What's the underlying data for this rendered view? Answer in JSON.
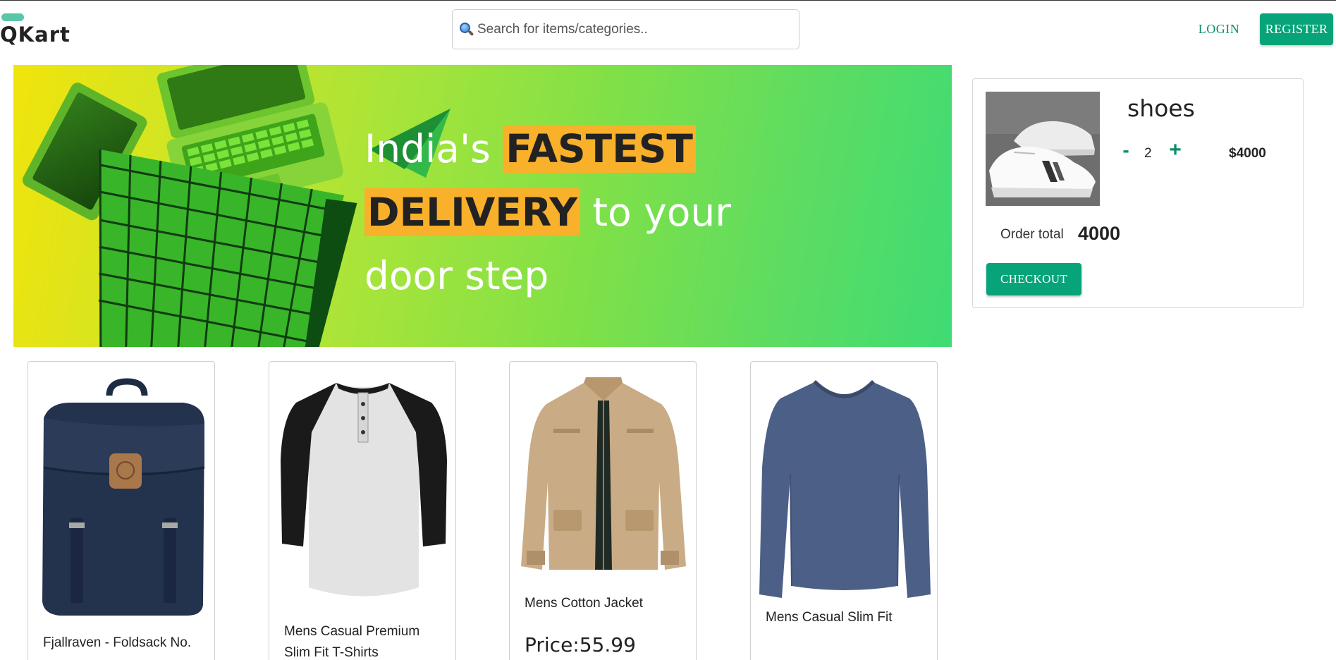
{
  "header": {
    "logo": "QKart",
    "search_placeholder": "Search for items/categories..",
    "login_label": "LOGIN",
    "register_label": "REGISTER"
  },
  "banner": {
    "line1_prefix": "India's ",
    "line1_highlight": "FASTEST",
    "line2_highlight": "DELIVERY",
    "line2_suffix": " to your",
    "line3": "door step"
  },
  "cart": {
    "item_name": "shoes",
    "quantity": "2",
    "minus_label": "-",
    "plus_label": "+",
    "item_price": "$4000",
    "order_total_label": "Order total",
    "order_total_value": "4000",
    "checkout_label": "CHECKOUT"
  },
  "products": [
    {
      "name": "Fjallraven - Foldsack No.",
      "price": ""
    },
    {
      "name_line1": "Mens Casual Premium",
      "name_line2": "Slim Fit T-Shirts",
      "price": ""
    },
    {
      "name": "Mens Cotton Jacket",
      "price": "Price:55.99"
    },
    {
      "name": "Mens Casual Slim Fit",
      "price": ""
    }
  ],
  "colors": {
    "brand_green": "#06a478",
    "highlight": "#f9b02a"
  },
  "icons": {
    "search": "search-icon"
  }
}
